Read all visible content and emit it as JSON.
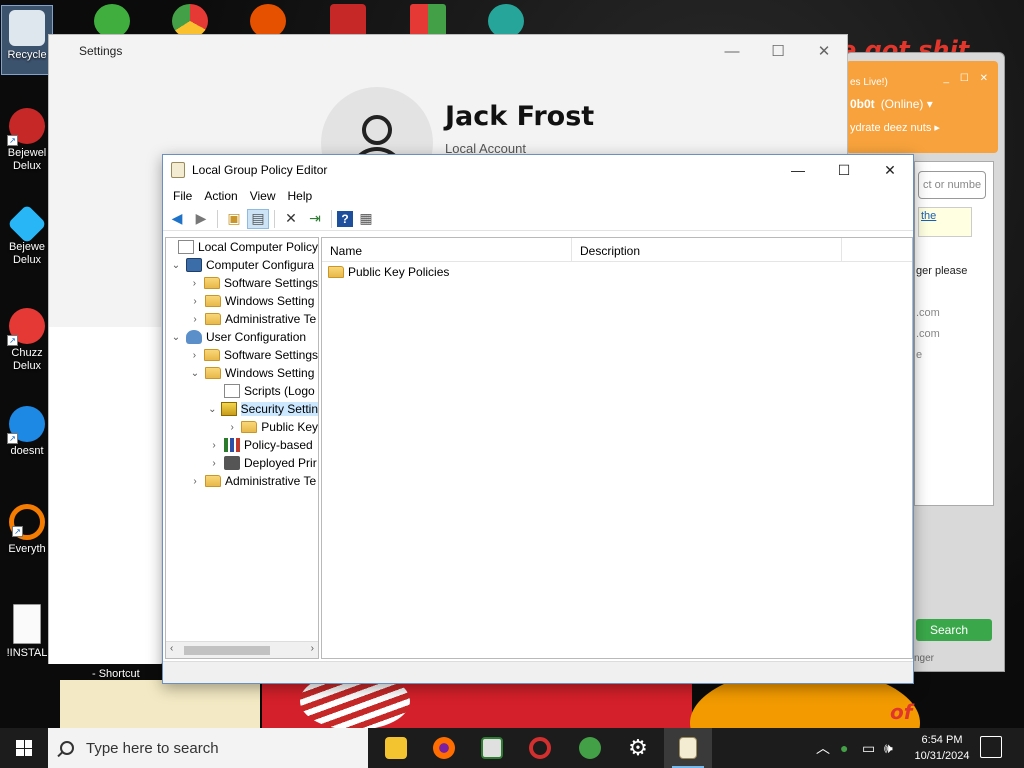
{
  "desktop": {
    "icons": [
      {
        "label": "Recycle",
        "name": "recycle-bin"
      },
      {
        "label": "Bejewel Delux",
        "name": "bejeweled-deluxe"
      },
      {
        "label": "Bejewe Delux",
        "name": "bejeweled-deluxe-2"
      },
      {
        "label": "Chuzz Delux",
        "name": "chuzzle-deluxe"
      },
      {
        "label": "doesnt",
        "name": "thunderbird-shortcut"
      },
      {
        "label": "Everyth",
        "name": "everything-search"
      },
      {
        "label": "!INSTAL",
        "name": "install-file"
      }
    ],
    "shortcut_label": "- Shortcut",
    "bg_text_top": "e got shit",
    "bg_text_bottom": "of"
  },
  "settings_window": {
    "title": "Settings",
    "user_name": "Jack Frost",
    "account_type": "Local Account",
    "controls": {
      "minimize": "—",
      "maximize": "☐",
      "close": "✕"
    }
  },
  "messenger": {
    "header_line1": "es Live!)",
    "header_user": "0b0t",
    "header_status": "(Online) ▾",
    "header_msg": "ydrate deez nuts ▸",
    "search_placeholder": "ct or numbe",
    "note_text": "the",
    "text_lines": [
      "ger please",
      ".com",
      ".com",
      "e"
    ],
    "search_button": "Search",
    "footer": "nger"
  },
  "gpedit": {
    "title": "Local Group Policy Editor",
    "controls": {
      "minimize": "—",
      "maximize": "☐",
      "close": "✕"
    },
    "menu": [
      "File",
      "Action",
      "View",
      "Help"
    ],
    "tree": [
      {
        "label": "Local Computer Policy",
        "level": 0,
        "exp": "",
        "icon": "doc"
      },
      {
        "label": "Computer Configura",
        "level": 0,
        "exp": "⌄",
        "icon": "pc"
      },
      {
        "label": "Software Settings",
        "level": 1,
        "exp": "›",
        "icon": "folder"
      },
      {
        "label": "Windows Setting",
        "level": 1,
        "exp": "›",
        "icon": "folder"
      },
      {
        "label": "Administrative Te",
        "level": 1,
        "exp": "›",
        "icon": "folder"
      },
      {
        "label": "User Configuration",
        "level": 0,
        "exp": "⌄",
        "icon": "usr"
      },
      {
        "label": "Software Settings",
        "level": 1,
        "exp": "›",
        "icon": "folder"
      },
      {
        "label": "Windows Setting",
        "level": 1,
        "exp": "⌄",
        "icon": "folder"
      },
      {
        "label": "Scripts (Logo",
        "level": 2,
        "exp": "",
        "icon": "doc"
      },
      {
        "label": "Security Settin",
        "level": 2,
        "exp": "⌄",
        "icon": "shield",
        "selected": true
      },
      {
        "label": "Public Key",
        "level": 3,
        "exp": "›",
        "icon": "folder"
      },
      {
        "label": "Policy-based",
        "level": 2,
        "exp": "›",
        "icon": "bars"
      },
      {
        "label": "Deployed Prir",
        "level": 2,
        "exp": "›",
        "icon": "printer"
      },
      {
        "label": "Administrative Te",
        "level": 1,
        "exp": "›",
        "icon": "folder"
      }
    ],
    "columns": [
      "Name",
      "Description"
    ],
    "rows": [
      {
        "name": "Public Key Policies",
        "description": ""
      }
    ]
  },
  "taskbar": {
    "search_placeholder": "Type here to search",
    "time": "6:54 PM",
    "date": "10/31/2024"
  }
}
